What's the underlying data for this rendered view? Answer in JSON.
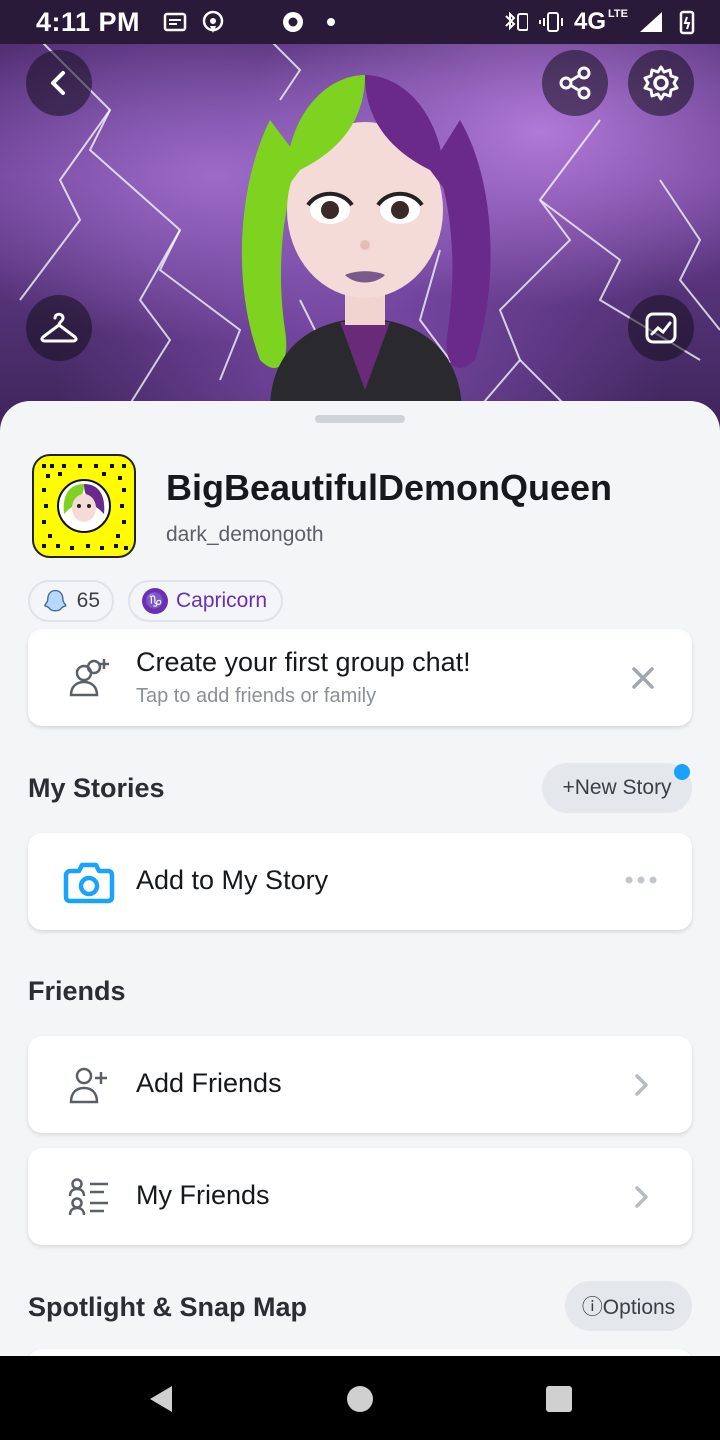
{
  "status_bar": {
    "time": "4:11 PM",
    "network": "4G",
    "network_sub": "LTE",
    "left_icons": [
      "message-icon",
      "podcast-icon",
      "chrome-icon",
      "dot-icon"
    ],
    "right_icons": [
      "bluetooth-battery-icon",
      "vibrate-icon",
      "signal-icon",
      "battery-icon"
    ]
  },
  "hero": {
    "buttons": [
      "back-icon",
      "share-icon",
      "settings-icon",
      "hanger-icon",
      "sticker-icon"
    ]
  },
  "profile": {
    "display_name": "BigBeautifulDemonQueen",
    "username": "dark_demongoth",
    "snap_score": "65",
    "zodiac": "Capricorn",
    "zodiac_symbol": "♑"
  },
  "group_prompt": {
    "title": "Create your first group chat!",
    "subtitle": "Tap to add friends or family"
  },
  "my_stories": {
    "title": "My Stories",
    "new_story_label": "+New Story",
    "add_label": "Add to My Story"
  },
  "friends": {
    "title": "Friends",
    "add_label": "Add Friends",
    "my_friends_label": "My Friends"
  },
  "spotlight": {
    "title": "Spotlight & Snap Map",
    "options_label": "ⓘOptions"
  },
  "colors": {
    "accent_blue": "#1aa2ff",
    "snap_yellow": "#fffc00",
    "zodiac_purple": "#6a2fb5"
  }
}
